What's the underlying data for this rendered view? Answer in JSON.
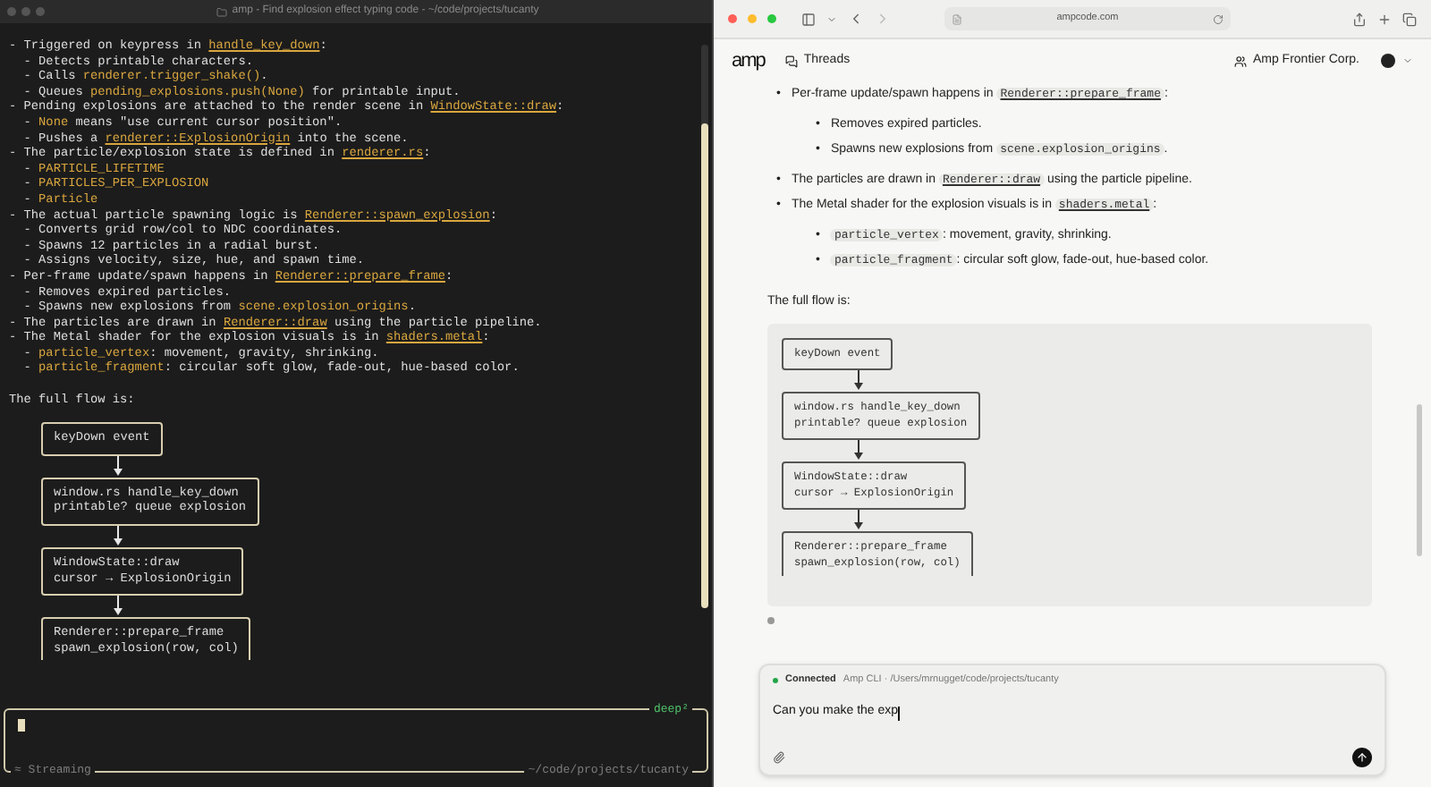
{
  "terminal": {
    "title": "amp - Find explosion effect typing code - ~/code/projects/tucanty",
    "bullet": "-",
    "items": [
      {
        "segments": [
          {
            "kind": "text",
            "text": "Triggered on keypress in "
          },
          {
            "kind": "link",
            "text": "handle_key_down"
          },
          {
            "kind": "text",
            "text": ":"
          }
        ],
        "children": [
          {
            "segments": [
              {
                "kind": "text",
                "text": "Detects printable characters."
              }
            ]
          },
          {
            "segments": [
              {
                "kind": "text",
                "text": "Calls "
              },
              {
                "kind": "code",
                "text": "renderer.trigger_shake()"
              },
              {
                "kind": "text",
                "text": "."
              }
            ]
          },
          {
            "segments": [
              {
                "kind": "text",
                "text": "Queues "
              },
              {
                "kind": "code",
                "text": "pending_explosions.push(None)"
              },
              {
                "kind": "text",
                "text": " for printable input."
              }
            ]
          }
        ]
      },
      {
        "segments": [
          {
            "kind": "text",
            "text": "Pending explosions are attached to the render scene in "
          },
          {
            "kind": "link",
            "text": "WindowState::draw"
          },
          {
            "kind": "text",
            "text": ":"
          }
        ],
        "children": [
          {
            "segments": [
              {
                "kind": "code",
                "text": "None"
              },
              {
                "kind": "text",
                "text": " means \"use current cursor position\"."
              }
            ]
          },
          {
            "segments": [
              {
                "kind": "text",
                "text": "Pushes a "
              },
              {
                "kind": "link",
                "text": "renderer::ExplosionOrigin"
              },
              {
                "kind": "text",
                "text": " into the scene."
              }
            ]
          }
        ]
      },
      {
        "segments": [
          {
            "kind": "text",
            "text": "The particle/explosion state is defined in "
          },
          {
            "kind": "link",
            "text": "renderer.rs"
          },
          {
            "kind": "text",
            "text": ":"
          }
        ],
        "children": [
          {
            "segments": [
              {
                "kind": "code",
                "text": "PARTICLE_LIFETIME"
              }
            ]
          },
          {
            "segments": [
              {
                "kind": "code",
                "text": "PARTICLES_PER_EXPLOSION"
              }
            ]
          },
          {
            "segments": [
              {
                "kind": "code",
                "text": "Particle"
              }
            ]
          }
        ]
      },
      {
        "segments": [
          {
            "kind": "text",
            "text": "The actual particle spawning logic is "
          },
          {
            "kind": "link",
            "text": "Renderer::spawn_explosion"
          },
          {
            "kind": "text",
            "text": ":"
          }
        ],
        "children": [
          {
            "segments": [
              {
                "kind": "text",
                "text": "Converts grid row/col to NDC coordinates."
              }
            ]
          },
          {
            "segments": [
              {
                "kind": "text",
                "text": "Spawns 12 particles in a radial burst."
              }
            ]
          },
          {
            "segments": [
              {
                "kind": "text",
                "text": "Assigns velocity, size, hue, and spawn time."
              }
            ]
          }
        ]
      },
      {
        "segments": [
          {
            "kind": "text",
            "text": "Per-frame update/spawn happens in "
          },
          {
            "kind": "link",
            "text": "Renderer::prepare_frame"
          },
          {
            "kind": "text",
            "text": ":"
          }
        ],
        "children": [
          {
            "segments": [
              {
                "kind": "text",
                "text": "Removes expired particles."
              }
            ]
          },
          {
            "segments": [
              {
                "kind": "text",
                "text": "Spawns new explosions from "
              },
              {
                "kind": "code",
                "text": "scene.explosion_origins"
              },
              {
                "kind": "text",
                "text": "."
              }
            ]
          }
        ]
      },
      {
        "segments": [
          {
            "kind": "text",
            "text": "The particles are drawn in "
          },
          {
            "kind": "link",
            "text": "Renderer::draw"
          },
          {
            "kind": "text",
            "text": " using the particle pipeline."
          }
        ]
      },
      {
        "segments": [
          {
            "kind": "text",
            "text": "The Metal shader for the explosion visuals is in "
          },
          {
            "kind": "link",
            "text": "shaders.metal"
          },
          {
            "kind": "text",
            "text": ":"
          }
        ],
        "children": [
          {
            "segments": [
              {
                "kind": "code",
                "text": "particle_vertex"
              },
              {
                "kind": "text",
                "text": ": movement, gravity, shrinking."
              }
            ]
          },
          {
            "segments": [
              {
                "kind": "code",
                "text": "particle_fragment"
              },
              {
                "kind": "text",
                "text": ": circular soft glow, fade-out, hue-based color."
              }
            ]
          }
        ]
      }
    ],
    "flow_intro": "The full flow is:",
    "flow": [
      {
        "lines": [
          "keyDown event"
        ],
        "cut": false
      },
      {
        "lines": [
          "window.rs handle_key_down",
          "printable? queue explosion"
        ],
        "cut": false
      },
      {
        "lines": [
          "WindowState::draw",
          "cursor → ExplosionOrigin"
        ],
        "cut": false
      },
      {
        "lines": [
          "Renderer::prepare_frame",
          "spawn_explosion(row, col)"
        ],
        "cut": true
      }
    ],
    "input": {
      "mode": "deep²",
      "status": "≈ Streaming",
      "path": "~/code/projects/tucanty"
    }
  },
  "browser": {
    "url": "ampcode.com",
    "logo": "amp",
    "threads": "Threads",
    "org": "Amp Frontier Corp.",
    "bullet": "•",
    "items": [
      {
        "segments": [
          {
            "kind": "text",
            "text": "Per-frame update/spawn happens in "
          },
          {
            "kind": "link",
            "text": "Renderer::prepare_frame"
          },
          {
            "kind": "text",
            "text": ":"
          }
        ],
        "children": [
          {
            "segments": [
              {
                "kind": "text",
                "text": "Removes expired particles."
              }
            ]
          },
          {
            "segments": [
              {
                "kind": "text",
                "text": "Spawns new explosions from "
              },
              {
                "kind": "code",
                "text": "scene.explosion_origins"
              },
              {
                "kind": "text",
                "text": "."
              }
            ]
          }
        ]
      },
      {
        "segments": [
          {
            "kind": "text",
            "text": "The particles are drawn in "
          },
          {
            "kind": "link",
            "text": "Renderer::draw"
          },
          {
            "kind": "text",
            "text": " using the particle pipeline."
          }
        ]
      },
      {
        "segments": [
          {
            "kind": "text",
            "text": "The Metal shader for the explosion visuals is in "
          },
          {
            "kind": "link",
            "text": "shaders.metal"
          },
          {
            "kind": "text",
            "text": ":"
          }
        ],
        "children": [
          {
            "segments": [
              {
                "kind": "code",
                "text": "particle_vertex"
              },
              {
                "kind": "text",
                "text": ": movement, gravity, shrinking."
              }
            ]
          },
          {
            "segments": [
              {
                "kind": "code",
                "text": "particle_fragment"
              },
              {
                "kind": "text",
                "text": ": circular soft glow, fade-out, hue-based color."
              }
            ]
          }
        ]
      }
    ],
    "flow_intro": "The full flow is:",
    "flow": [
      {
        "lines": [
          "keyDown event"
        ],
        "cut": false
      },
      {
        "lines": [
          "window.rs handle_key_down",
          "printable? queue explosion"
        ],
        "cut": false
      },
      {
        "lines": [
          "WindowState::draw",
          "cursor → ExplosionOrigin"
        ],
        "cut": false
      },
      {
        "lines": [
          "Renderer::prepare_frame",
          "spawn_explosion(row, col)"
        ],
        "cut": true
      }
    ],
    "composer": {
      "connected": true,
      "status": "Connected",
      "source": "Amp CLI · /Users/mrnugget/code/projects/tucanty",
      "value": "Can you make the exp"
    }
  }
}
